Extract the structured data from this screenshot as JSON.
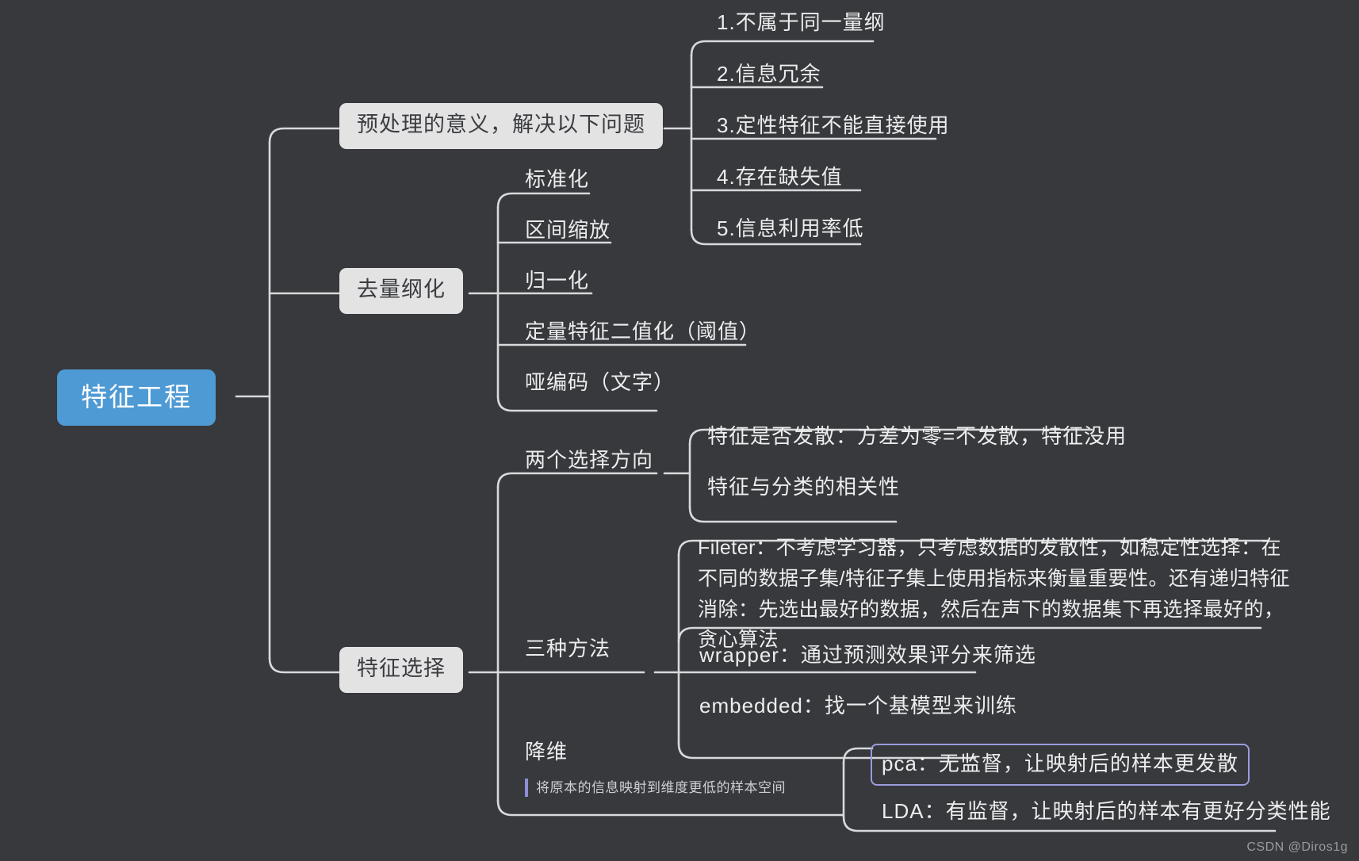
{
  "canvas": {
    "background": "#37393d",
    "root_fill": "#4e9ad4",
    "box_fill": "#e3e3e4",
    "line_color": "#d8d9da",
    "selected_border": "#9a9cdb",
    "text_light": "#eceded"
  },
  "mindmap": {
    "root": {
      "label": "特征工程"
    },
    "branches": [
      {
        "id": "preprocess",
        "label": "预处理的意义，解决以下问题",
        "children": [
          {
            "label": "1.不属于同一量纲"
          },
          {
            "label": "2.信息冗余"
          },
          {
            "label": "3.定性特征不能直接使用"
          },
          {
            "label": "4.存在缺失值"
          },
          {
            "label": "5.信息利用率低"
          }
        ]
      },
      {
        "id": "dedimension",
        "label": "去量纲化",
        "children": [
          {
            "label": "标准化"
          },
          {
            "label": "区间缩放"
          },
          {
            "label": "归一化"
          },
          {
            "label": "定量特征二值化（阈值）"
          },
          {
            "label": "哑编码（文字）"
          }
        ]
      },
      {
        "id": "feature-selection",
        "label": "特征选择",
        "children": [
          {
            "id": "two-directions",
            "label": "两个选择方向",
            "children": [
              {
                "label": "特征是否发散：方差为零=不发散，特征没用"
              },
              {
                "label": "特征与分类的相关性"
              }
            ]
          },
          {
            "id": "three-methods",
            "label": "三种方法",
            "children": [
              {
                "label": "Fileter：不考虑学习器，只考虑数据的发散性，如稳定性选择：在不同的数据子集/特征子集上使用指标来衡量重要性。还有递归特征消除：先选出最好的数据，然后在声下的数据集下再选择最好的，贪心算法"
              },
              {
                "label": "wrapper：通过预测效果评分来筛选"
              },
              {
                "label": "embedded：找一个基模型来训练"
              }
            ]
          },
          {
            "id": "dimension-reduction",
            "label": "降维",
            "note": "将原本的信息映射到维度更低的样本空间",
            "children": [
              {
                "label": "pca：无监督，让映射后的样本更发散",
                "selected": true
              },
              {
                "label": "LDA：有监督，让映射后的样本有更好分类性能"
              }
            ]
          }
        ]
      }
    ]
  },
  "watermark": {
    "text": "CSDN @Diros1g"
  }
}
